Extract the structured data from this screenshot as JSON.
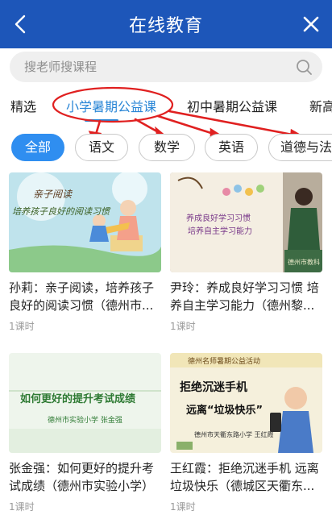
{
  "header": {
    "title": "在线教育",
    "back_icon": "chevron-left-icon",
    "close_icon": "close-icon",
    "color": "#1d56b9"
  },
  "search": {
    "placeholder": "搜老师搜课程",
    "icon": "search-icon"
  },
  "category_tabs": [
    {
      "label": "精选"
    },
    {
      "label": "小学暑期公益课",
      "active": true
    },
    {
      "label": "初中暑期公益课"
    },
    {
      "label": "新高"
    }
  ],
  "subject_chips": [
    {
      "label": "全部",
      "active": true
    },
    {
      "label": "语文"
    },
    {
      "label": "数学"
    },
    {
      "label": "英语"
    },
    {
      "label": "道德与法"
    }
  ],
  "courses": [
    {
      "title": "孙莉：亲子阅读，培养孩子良好的阅读习惯（德州市...",
      "lessons": "1课时",
      "thumb_text": [
        "亲子阅读",
        "培养孩子良好的阅读习惯"
      ]
    },
    {
      "title": "尹玲：养成良好学习习惯 培养自主学习能力（德州黎...",
      "lessons": "1课时",
      "thumb_text": [
        "养成良好学习习惯",
        "培养自主学习能力",
        "德州市教科"
      ]
    },
    {
      "title": "张金强：如何更好的提升考试成绩（德州市实验小学）",
      "lessons": "1课时",
      "thumb_text": [
        "如何更好的提升考试成绩",
        "德州市实验小学  张金强"
      ]
    },
    {
      "title": "王红霞：拒绝沉迷手机 远离垃圾快乐（德城区天衢东...",
      "lessons": "1课时",
      "thumb_text": [
        "德州名师暑期公益活动",
        "拒绝沉迷手机",
        "远离“垃圾快乐”",
        "德州市天衢东路小学  王红霞"
      ]
    }
  ],
  "colors": {
    "accent": "#2a86d6",
    "chip_active": "#2f8ef0",
    "annotation": "#e02020"
  }
}
